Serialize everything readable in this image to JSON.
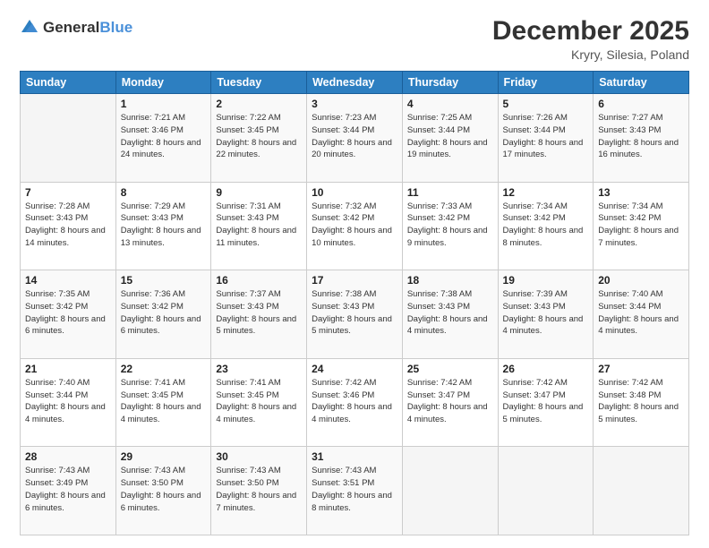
{
  "logo": {
    "text_general": "General",
    "text_blue": "Blue"
  },
  "header": {
    "month": "December 2025",
    "location": "Kryry, Silesia, Poland"
  },
  "weekdays": [
    "Sunday",
    "Monday",
    "Tuesday",
    "Wednesday",
    "Thursday",
    "Friday",
    "Saturday"
  ],
  "weeks": [
    [
      {
        "day": "",
        "sunrise": "",
        "sunset": "",
        "daylight": ""
      },
      {
        "day": "1",
        "sunrise": "Sunrise: 7:21 AM",
        "sunset": "Sunset: 3:46 PM",
        "daylight": "Daylight: 8 hours and 24 minutes."
      },
      {
        "day": "2",
        "sunrise": "Sunrise: 7:22 AM",
        "sunset": "Sunset: 3:45 PM",
        "daylight": "Daylight: 8 hours and 22 minutes."
      },
      {
        "day": "3",
        "sunrise": "Sunrise: 7:23 AM",
        "sunset": "Sunset: 3:44 PM",
        "daylight": "Daylight: 8 hours and 20 minutes."
      },
      {
        "day": "4",
        "sunrise": "Sunrise: 7:25 AM",
        "sunset": "Sunset: 3:44 PM",
        "daylight": "Daylight: 8 hours and 19 minutes."
      },
      {
        "day": "5",
        "sunrise": "Sunrise: 7:26 AM",
        "sunset": "Sunset: 3:44 PM",
        "daylight": "Daylight: 8 hours and 17 minutes."
      },
      {
        "day": "6",
        "sunrise": "Sunrise: 7:27 AM",
        "sunset": "Sunset: 3:43 PM",
        "daylight": "Daylight: 8 hours and 16 minutes."
      }
    ],
    [
      {
        "day": "7",
        "sunrise": "Sunrise: 7:28 AM",
        "sunset": "Sunset: 3:43 PM",
        "daylight": "Daylight: 8 hours and 14 minutes."
      },
      {
        "day": "8",
        "sunrise": "Sunrise: 7:29 AM",
        "sunset": "Sunset: 3:43 PM",
        "daylight": "Daylight: 8 hours and 13 minutes."
      },
      {
        "day": "9",
        "sunrise": "Sunrise: 7:31 AM",
        "sunset": "Sunset: 3:43 PM",
        "daylight": "Daylight: 8 hours and 11 minutes."
      },
      {
        "day": "10",
        "sunrise": "Sunrise: 7:32 AM",
        "sunset": "Sunset: 3:42 PM",
        "daylight": "Daylight: 8 hours and 10 minutes."
      },
      {
        "day": "11",
        "sunrise": "Sunrise: 7:33 AM",
        "sunset": "Sunset: 3:42 PM",
        "daylight": "Daylight: 8 hours and 9 minutes."
      },
      {
        "day": "12",
        "sunrise": "Sunrise: 7:34 AM",
        "sunset": "Sunset: 3:42 PM",
        "daylight": "Daylight: 8 hours and 8 minutes."
      },
      {
        "day": "13",
        "sunrise": "Sunrise: 7:34 AM",
        "sunset": "Sunset: 3:42 PM",
        "daylight": "Daylight: 8 hours and 7 minutes."
      }
    ],
    [
      {
        "day": "14",
        "sunrise": "Sunrise: 7:35 AM",
        "sunset": "Sunset: 3:42 PM",
        "daylight": "Daylight: 8 hours and 6 minutes."
      },
      {
        "day": "15",
        "sunrise": "Sunrise: 7:36 AM",
        "sunset": "Sunset: 3:42 PM",
        "daylight": "Daylight: 8 hours and 6 minutes."
      },
      {
        "day": "16",
        "sunrise": "Sunrise: 7:37 AM",
        "sunset": "Sunset: 3:43 PM",
        "daylight": "Daylight: 8 hours and 5 minutes."
      },
      {
        "day": "17",
        "sunrise": "Sunrise: 7:38 AM",
        "sunset": "Sunset: 3:43 PM",
        "daylight": "Daylight: 8 hours and 5 minutes."
      },
      {
        "day": "18",
        "sunrise": "Sunrise: 7:38 AM",
        "sunset": "Sunset: 3:43 PM",
        "daylight": "Daylight: 8 hours and 4 minutes."
      },
      {
        "day": "19",
        "sunrise": "Sunrise: 7:39 AM",
        "sunset": "Sunset: 3:43 PM",
        "daylight": "Daylight: 8 hours and 4 minutes."
      },
      {
        "day": "20",
        "sunrise": "Sunrise: 7:40 AM",
        "sunset": "Sunset: 3:44 PM",
        "daylight": "Daylight: 8 hours and 4 minutes."
      }
    ],
    [
      {
        "day": "21",
        "sunrise": "Sunrise: 7:40 AM",
        "sunset": "Sunset: 3:44 PM",
        "daylight": "Daylight: 8 hours and 4 minutes."
      },
      {
        "day": "22",
        "sunrise": "Sunrise: 7:41 AM",
        "sunset": "Sunset: 3:45 PM",
        "daylight": "Daylight: 8 hours and 4 minutes."
      },
      {
        "day": "23",
        "sunrise": "Sunrise: 7:41 AM",
        "sunset": "Sunset: 3:45 PM",
        "daylight": "Daylight: 8 hours and 4 minutes."
      },
      {
        "day": "24",
        "sunrise": "Sunrise: 7:42 AM",
        "sunset": "Sunset: 3:46 PM",
        "daylight": "Daylight: 8 hours and 4 minutes."
      },
      {
        "day": "25",
        "sunrise": "Sunrise: 7:42 AM",
        "sunset": "Sunset: 3:47 PM",
        "daylight": "Daylight: 8 hours and 4 minutes."
      },
      {
        "day": "26",
        "sunrise": "Sunrise: 7:42 AM",
        "sunset": "Sunset: 3:47 PM",
        "daylight": "Daylight: 8 hours and 5 minutes."
      },
      {
        "day": "27",
        "sunrise": "Sunrise: 7:42 AM",
        "sunset": "Sunset: 3:48 PM",
        "daylight": "Daylight: 8 hours and 5 minutes."
      }
    ],
    [
      {
        "day": "28",
        "sunrise": "Sunrise: 7:43 AM",
        "sunset": "Sunset: 3:49 PM",
        "daylight": "Daylight: 8 hours and 6 minutes."
      },
      {
        "day": "29",
        "sunrise": "Sunrise: 7:43 AM",
        "sunset": "Sunset: 3:50 PM",
        "daylight": "Daylight: 8 hours and 6 minutes."
      },
      {
        "day": "30",
        "sunrise": "Sunrise: 7:43 AM",
        "sunset": "Sunset: 3:50 PM",
        "daylight": "Daylight: 8 hours and 7 minutes."
      },
      {
        "day": "31",
        "sunrise": "Sunrise: 7:43 AM",
        "sunset": "Sunset: 3:51 PM",
        "daylight": "Daylight: 8 hours and 8 minutes."
      },
      {
        "day": "",
        "sunrise": "",
        "sunset": "",
        "daylight": ""
      },
      {
        "day": "",
        "sunrise": "",
        "sunset": "",
        "daylight": ""
      },
      {
        "day": "",
        "sunrise": "",
        "sunset": "",
        "daylight": ""
      }
    ]
  ]
}
